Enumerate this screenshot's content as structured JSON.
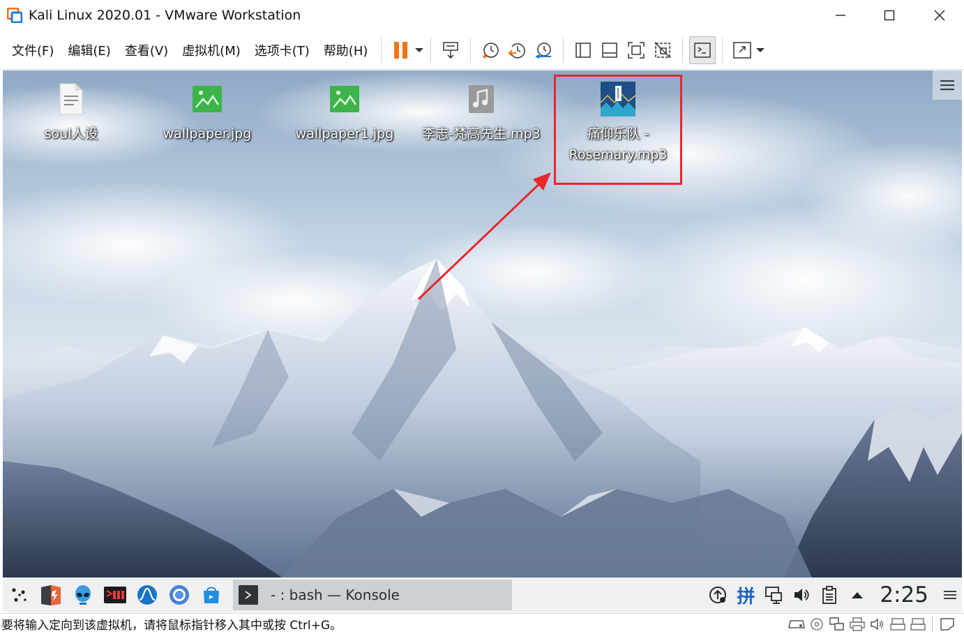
{
  "window": {
    "title": "Kali Linux 2020.01 - VMware Workstation",
    "icon": "vmware-icon",
    "controls": [
      "minimize-icon",
      "maximize-icon",
      "close-icon"
    ]
  },
  "menu": {
    "items": [
      "文件(F)",
      "编辑(E)",
      "查看(V)",
      "虚拟机(M)",
      "选项卡(T)",
      "帮助(H)"
    ]
  },
  "toolbar": {
    "buttons": [
      "pause-icon",
      "send-ctrl-alt-del-icon",
      "snapshot-icon",
      "revert-snapshot-icon",
      "snapshot-manager-icon",
      "library-icon",
      "thumbnail-bar-icon",
      "fullscreen-icon",
      "unity-icon",
      "console-view-icon",
      "stretch-guest-icon"
    ],
    "accent": "#f47216"
  },
  "desktop": {
    "icons": [
      {
        "label": "soul人设",
        "type": "text-file-icon"
      },
      {
        "label": "wallpaper.jpg",
        "type": "image-file-icon"
      },
      {
        "label": "wallpaper1.jpg",
        "type": "image-file-icon"
      },
      {
        "label": "李志-梵高先生.mp3",
        "type": "audio-file-icon"
      },
      {
        "label": "痛仰乐队 - Rosemary.mp3",
        "type": "album-art-icon"
      }
    ],
    "highlight_color": "#e8262c",
    "menu_icon": "hamburger-menu-icon"
  },
  "taskbar": {
    "launchers": [
      "application-launcher-icon",
      "burpsuite-icon",
      "metasploit-icon",
      "terminal-icon",
      "wireshark-icon",
      "chromium-icon",
      "file-manager-icon"
    ],
    "task_label": "- : bash — Konsole",
    "tray": [
      "updates-icon",
      "input-method-icon",
      "network-icon",
      "volume-icon",
      "clipboard-icon",
      "expand-tray-icon"
    ],
    "input_method": "拼",
    "clock": "2:25"
  },
  "statusbar": {
    "message": "要将输入定向到该虚拟机，请将鼠标指针移入其中或按 Ctrl+G。",
    "icons": [
      "hard-disk-icon",
      "cd-dvd-icon",
      "network-adapter-icon",
      "printer-icon",
      "sound-card-icon",
      "usb-icon",
      "usb-icon-2",
      "message-icon"
    ]
  }
}
